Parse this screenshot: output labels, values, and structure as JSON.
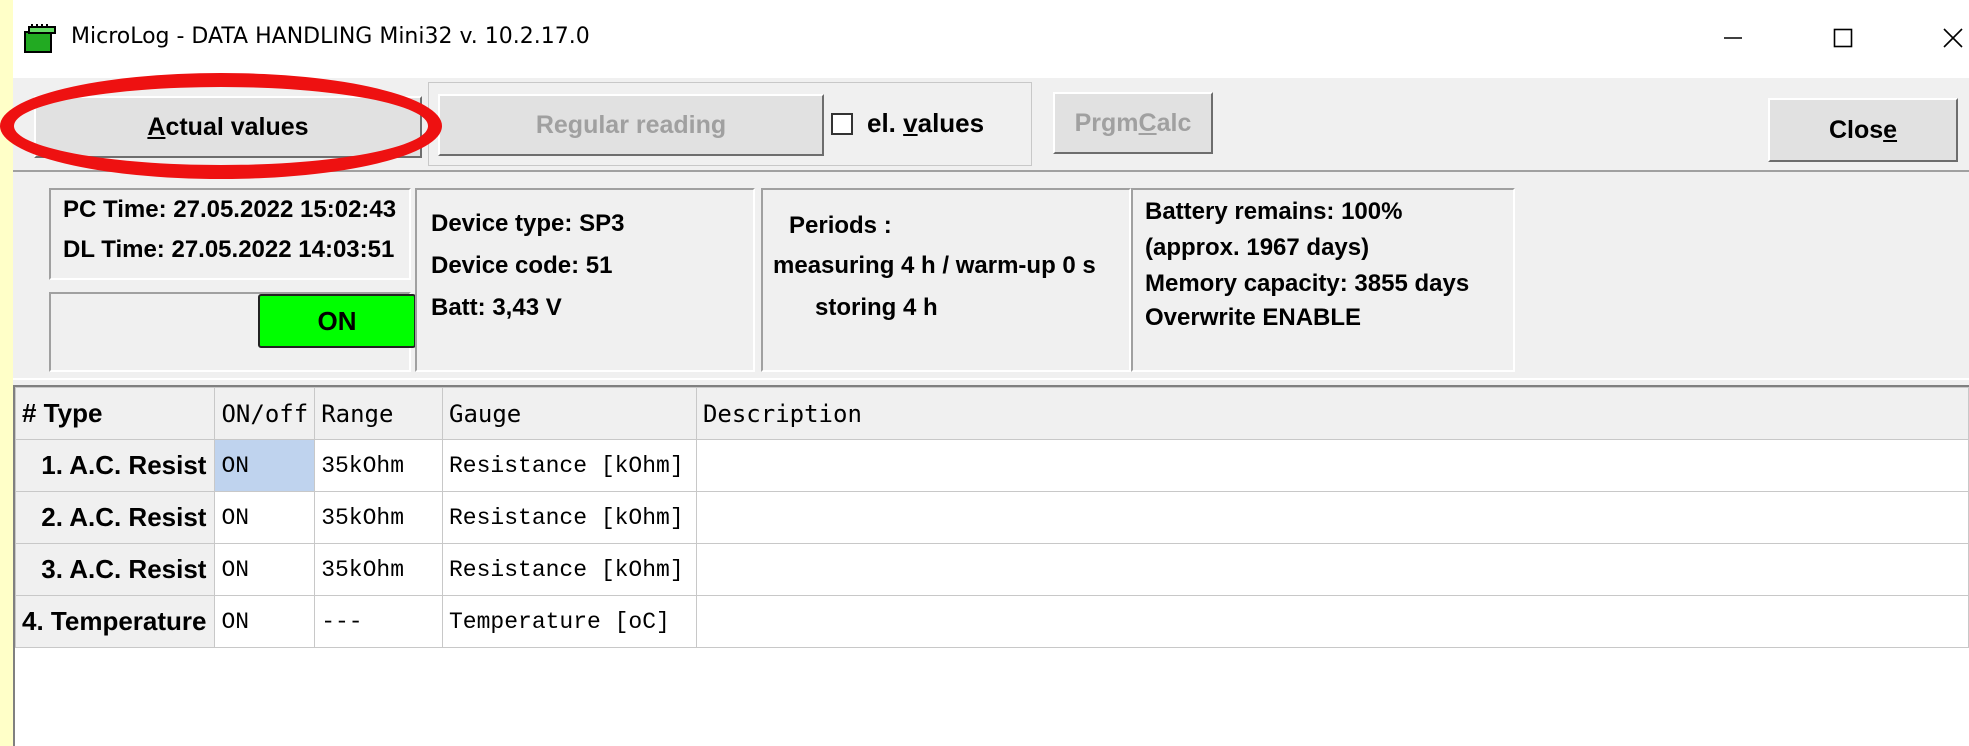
{
  "window": {
    "title": "MicroLog - DATA HANDLING   Mini32 v. 10.2.17.0",
    "icon": "app-icon"
  },
  "toolbar": {
    "actual_values": "Actual values",
    "regular_reading": "Regular reading",
    "el_values": "el. values",
    "el_values_checked": false,
    "prgm_calc": "PrgmCalc",
    "close": "Close"
  },
  "info": {
    "pc_time": "PC Time: 27.05.2022 15:02:43",
    "dl_time": "DL Time: 27.05.2022 14:03:51",
    "status": "ON",
    "status_color": "#00ff00",
    "device_type": "Device type: SP3",
    "device_code": "Device code: 51",
    "batt": "Batt: 3,43 V",
    "periods_title": "Periods :",
    "measuring": "measuring  4 h / warm-up 0 s",
    "storing": "storing  4 h",
    "battery_remains": "Battery remains: 100%",
    "approx_days": "(approx. 1967 days)",
    "memory_capacity": "Memory capacity: 3855 days",
    "overwrite": "Overwrite ENABLE"
  },
  "table": {
    "headers": [
      "# Type",
      "ON/off",
      "Range",
      "Gauge",
      "Description"
    ],
    "rows": [
      {
        "type": "1. A.C. Resist",
        "onoff": "ON",
        "range": "35kOhm",
        "gauge": "Resistance [kOhm]",
        "description": ""
      },
      {
        "type": "2. A.C. Resist",
        "onoff": "ON",
        "range": "35kOhm",
        "gauge": "Resistance [kOhm]",
        "description": ""
      },
      {
        "type": "3. A.C. Resist",
        "onoff": "ON",
        "range": "35kOhm",
        "gauge": "Resistance [kOhm]",
        "description": ""
      },
      {
        "type": "4. Temperature",
        "onoff": "ON",
        "range": "---",
        "gauge": "Temperature [oC]",
        "description": ""
      }
    ]
  },
  "colors": {
    "annotation": "#ee1111",
    "selected_cell": "#bfd3ee"
  }
}
